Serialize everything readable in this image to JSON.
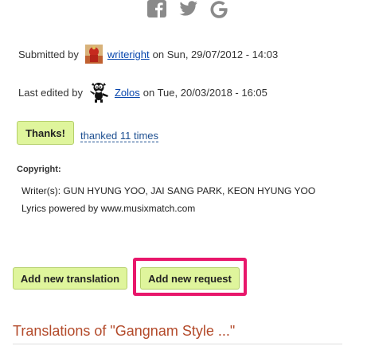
{
  "social": {
    "icons": [
      "facebook-icon",
      "twitter-icon",
      "google-icon"
    ]
  },
  "submitted": {
    "prefix": "Submitted by",
    "user": "writeright",
    "suffix": "on Sun, 29/07/2012 - 14:03"
  },
  "edited": {
    "prefix": "Last edited by",
    "user": "Zolos",
    "suffix": "on Tue, 20/03/2018 - 16:05"
  },
  "thanks": {
    "button_label": "Thanks!",
    "count_text": "thanked 11 times"
  },
  "copyright": {
    "label": "Copyright:",
    "writers": "Writer(s): GUN HYUNG YOO, JAI SANG PARK, KEON HYUNG YOO",
    "powered": "Lyrics powered by www.musixmatch.com"
  },
  "actions": {
    "add_translation": "Add new translation",
    "add_request": "Add new request"
  },
  "translations": {
    "title": "Translations of \"Gangnam Style ...\""
  },
  "colors": {
    "button_bg": "#dff59c",
    "highlight": "#e8176b",
    "link": "#0645ad",
    "heading": "#b34a2a"
  }
}
